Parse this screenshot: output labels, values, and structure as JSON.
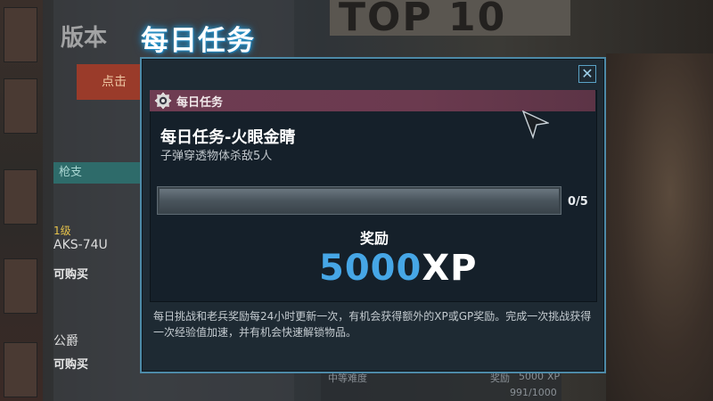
{
  "background": {
    "top_banner": "TOP 10",
    "version_text": "版本",
    "red_button": "点击",
    "tab_label": "枪支",
    "cards": [
      {
        "level": "1级",
        "name": "AKS-74U",
        "buy": "可购买"
      },
      {
        "level": "",
        "name": "公爵",
        "buy": "可购买"
      }
    ],
    "bottom_info": {
      "title": "中等难度",
      "reward_label": "奖励",
      "reward_value": "5000",
      "reward_unit": "XP",
      "progress": "991/1000"
    }
  },
  "title": "每日任务",
  "dialog": {
    "close_icon": "close-icon",
    "header": {
      "icon": "badge-icon",
      "label": "每日任务"
    },
    "mission": {
      "title": "每日任务-火眼金睛",
      "description": "子弹穿透物体杀敌5人",
      "progress_current": 0,
      "progress_total": 5,
      "progress_text": "0/5"
    },
    "reward": {
      "label": "奖励",
      "amount": "5000",
      "unit": "XP"
    },
    "footer": "每日挑战和老兵奖励每24小时更新一次，有机会获得额外的XP或GP奖励。完成一次挑战获得一次经验值加速，并有机会快速解锁物品。"
  },
  "colors": {
    "accent_blue": "#46a6e6",
    "header_purple": "#6e3c52",
    "dialog_border": "#4d8aa8"
  }
}
